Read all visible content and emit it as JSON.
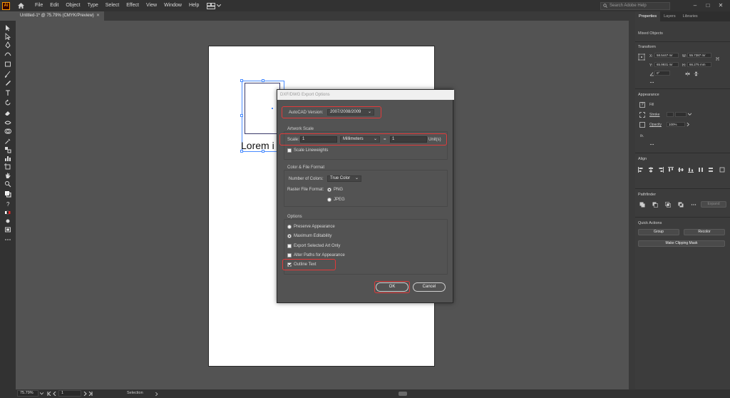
{
  "menubar": {
    "logo": "Ai",
    "items": [
      "File",
      "Edit",
      "Object",
      "Type",
      "Select",
      "Effect",
      "View",
      "Window",
      "Help"
    ],
    "search_placeholder": "Search Adobe Help"
  },
  "document": {
    "tab_title": "Untitled-1* @ 75.79% (CMYK/Preview)",
    "canvas_text": "Lorem i"
  },
  "panel": {
    "tabs": [
      "Properties",
      "Layers",
      "Libraries"
    ],
    "selection_label": "Mixed Objects",
    "transform": {
      "title": "Transform",
      "x_label": "X:",
      "x_value": "58.5447 mr",
      "y_label": "Y:",
      "y_value": "65.9931 mr",
      "w_label": "W:",
      "w_value": "55.7387 mr",
      "h_label": "H:",
      "h_value": "66.275 mm",
      "rotate_value": "0°"
    },
    "appearance": {
      "title": "Appearance",
      "fill_label": "Fill",
      "stroke_label": "Stroke",
      "opacity_label": "Opacity",
      "opacity_value": "100%",
      "fx_label": "fx."
    },
    "align_title": "Align",
    "pathfinder": {
      "title": "Pathfinder",
      "expand_label": "Expand"
    },
    "quick_actions": {
      "title": "Quick Actions",
      "group_label": "Group",
      "recolor_label": "Recolor",
      "clipping_mask_label": "Make Clipping Mask"
    }
  },
  "statusbar": {
    "zoom": "75.79%",
    "artboard_number": "1",
    "tool_name": "Selection"
  },
  "dialog": {
    "title": "DXF/DWG Export Options",
    "autocad_version_label": "AutoCAD Version:",
    "autocad_version_value": "2007/2008/2009",
    "artwork_scale_title": "Artwork Scale",
    "scale_label": "Scale:",
    "scale_value": "1",
    "units_value": "Millimeters",
    "equals": "=",
    "unit_value": "1",
    "unit_label": "Unit(s)",
    "scale_lineweights_label": "Scale Lineweights",
    "color_format_title": "Color & File Format",
    "num_colors_label": "Number of Colors:",
    "num_colors_value": "True Color",
    "raster_format_label": "Raster File Format:",
    "png_label": "PNG",
    "jpeg_label": "JPEG",
    "options_title": "Options",
    "preserve_label": "Preserve Appearance",
    "max_edit_label": "Maximum Editability",
    "export_selected_label": "Export Selected Art Only",
    "alter_paths_label": "Alter Paths for Appearance",
    "outline_text_label": "Outline Text",
    "ok_label": "OK",
    "cancel_label": "Cancel"
  },
  "colors": {
    "highlight": "#e23a3a",
    "selection_blue": "#4a8cff",
    "app_bg": "#535353"
  }
}
